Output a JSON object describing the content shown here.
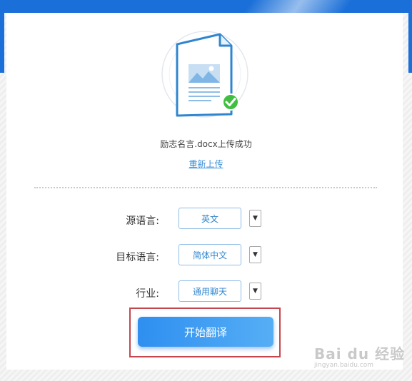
{
  "upload": {
    "message": "励志名言.docx上传成功",
    "reupload_link": "重新上传"
  },
  "form": {
    "source_language": {
      "label": "源语言:",
      "value": "英文"
    },
    "target_language": {
      "label": "目标语言:",
      "value": "简体中文"
    },
    "industry": {
      "label": "行业:",
      "value": "通用聊天"
    }
  },
  "actions": {
    "start_button": "开始翻译"
  },
  "watermark": {
    "main": "Bai du 经验",
    "sub": "jingyan.baidu.com"
  },
  "colors": {
    "accent": "#1a6fd8",
    "button_start": "#2e8ff0",
    "button_end": "#56aef5",
    "highlight_border": "#c4474f",
    "success_check": "#3fbf3f"
  },
  "icons": {
    "arrow": "▼"
  }
}
